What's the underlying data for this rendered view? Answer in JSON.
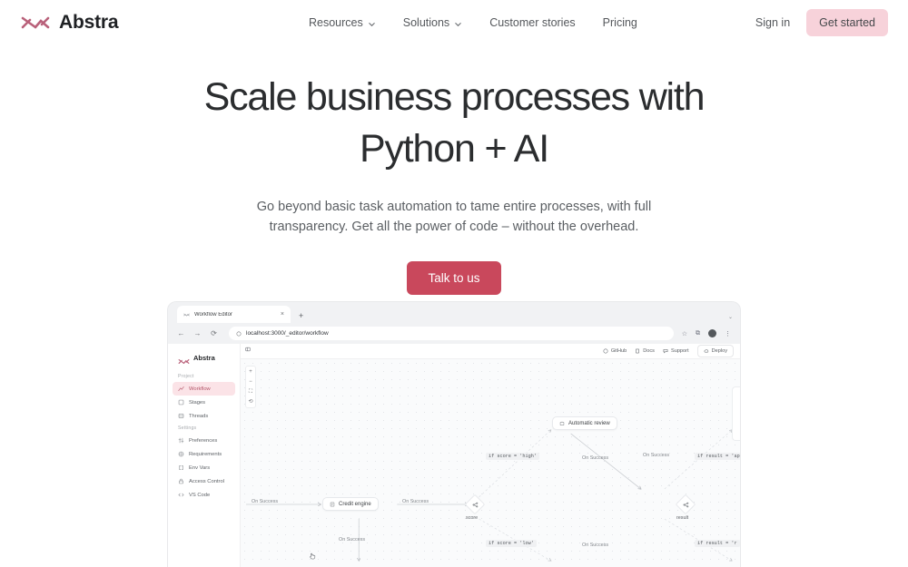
{
  "site": {
    "brand_name": "Abstra",
    "logo_icon": "abstra-x-logo-icon",
    "accent_pink": "#f7d2da",
    "accent_red": "#c9485c"
  },
  "nav": {
    "links": [
      {
        "label": "Resources",
        "has_caret": true,
        "icon": "chevron-down-icon"
      },
      {
        "label": "Solutions",
        "has_caret": true,
        "icon": "chevron-down-icon"
      },
      {
        "label": "Customer stories",
        "has_caret": false
      },
      {
        "label": "Pricing",
        "has_caret": false
      }
    ],
    "sign_in": "Sign in",
    "get_started": "Get started"
  },
  "hero": {
    "heading_line1": "Scale business processes with",
    "heading_line2": "Python + AI",
    "subheading": "Go beyond basic task automation to tame entire processes, with full transparency. Get all the power of code – without the overhead.",
    "cta": "Talk to us"
  },
  "browser": {
    "tab_title": "Workflow Editor",
    "tab_favicon": "abstra-favicon-icon",
    "tab_close": "×",
    "new_tab": "+",
    "back": "←",
    "forward": "→",
    "reload": "⟳",
    "url": "localhost:3000/_editor/workflow",
    "url_info_icon": "info-circle-icon",
    "bookmark_icon": "star-icon",
    "extensions_icon": "extensions-icon",
    "profile_icon": "profile-avatar-icon",
    "menu_icon": "three-dot-menu-icon"
  },
  "app": {
    "brand_name": "Abstra",
    "sidebar": {
      "sections": [
        {
          "label": "Project",
          "items": [
            {
              "label": "Workflow",
              "icon": "workflow-icon",
              "active": true
            },
            {
              "label": "Stages",
              "icon": "stages-icon",
              "active": false
            },
            {
              "label": "Threads",
              "icon": "threads-icon",
              "active": false
            }
          ]
        },
        {
          "label": "Settings",
          "items": [
            {
              "label": "Preferences",
              "icon": "sliders-icon",
              "active": false
            },
            {
              "label": "Requirements",
              "icon": "package-icon",
              "active": false
            },
            {
              "label": "Env Vars",
              "icon": "brackets-icon",
              "active": false
            },
            {
              "label": "Access Control",
              "icon": "lock-icon",
              "active": false
            },
            {
              "label": "VS Code",
              "icon": "code-icon",
              "active": false
            }
          ]
        }
      ]
    },
    "topbar": {
      "items": [
        {
          "label": "GitHub",
          "icon": "github-icon"
        },
        {
          "label": "Docs",
          "icon": "docs-icon"
        },
        {
          "label": "Support",
          "icon": "support-icon"
        },
        {
          "label": "Deploy",
          "icon": "deploy-cloud-icon"
        }
      ]
    },
    "canvas": {
      "panel_toggle_icon": "panel-toggle-icon",
      "zoom_controls": [
        {
          "label": "+",
          "name": "zoom-in-button"
        },
        {
          "label": "−",
          "name": "zoom-out-button"
        },
        {
          "label": "⛶",
          "name": "fit-view-button"
        },
        {
          "label": "⟲",
          "name": "reset-view-button"
        }
      ],
      "nodes": [
        {
          "label": "Credit engine",
          "icon": "credit-engine-icon"
        },
        {
          "label": "Automatic review",
          "icon": "automatic-review-icon"
        }
      ],
      "decisions": [
        {
          "label": "score",
          "icon": "branch-icon"
        },
        {
          "label": "result",
          "icon": "branch-icon"
        }
      ],
      "edge_labels": [
        "On Success",
        "On Success",
        "On Success",
        "On Success",
        "On Success",
        "On Success"
      ],
      "condition_labels": [
        "if score = 'high'",
        "if result = 'app",
        "if score = 'low'",
        "if result = 'r"
      ],
      "cursor_icon": "grab-cursor-icon"
    }
  }
}
